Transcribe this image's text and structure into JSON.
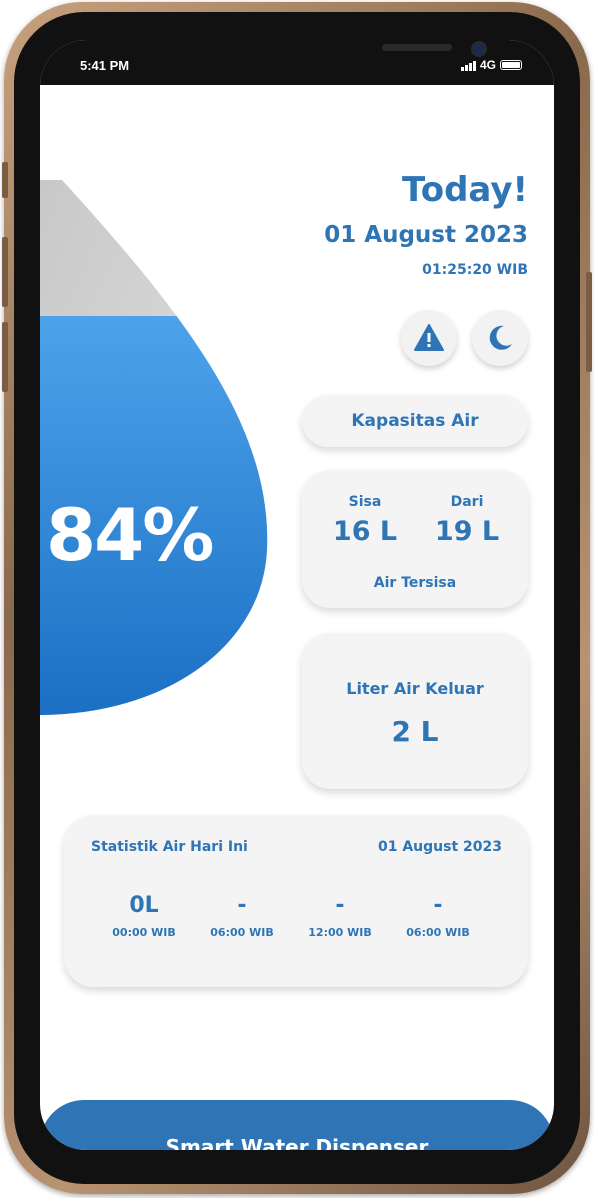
{
  "status_bar": {
    "time": "5:41 PM",
    "network": "4G",
    "icons": [
      "signal-icon",
      "battery-icon"
    ]
  },
  "header": {
    "title": "Today!",
    "date": "01 August 2023",
    "time": "01:25:20 WIB"
  },
  "actions": {
    "warning_icon": "warning-icon",
    "dark_mode_icon": "moon-icon"
  },
  "water_level": {
    "percent_label": "84%",
    "fill_fraction": 0.84
  },
  "capacity": {
    "label": "Kapasitas Air"
  },
  "remaining": {
    "sisa_label": "Sisa",
    "sisa_value": "16 L",
    "dari_label": "Dari",
    "dari_value": "19 L",
    "caption": "Air Tersisa"
  },
  "dispensed": {
    "label": "Liter Air Keluar",
    "value": "2 L"
  },
  "statistics": {
    "title": "Statistik Air Hari Ini",
    "date": "01 August 2023",
    "slots": [
      {
        "value": "0L",
        "time": "00:00 WIB"
      },
      {
        "value": "-",
        "time": "06:00 WIB"
      },
      {
        "value": "-",
        "time": "12:00 WIB"
      },
      {
        "value": "-",
        "time": "06:00 WIB"
      }
    ]
  },
  "footer": {
    "title": "Smart Water Dispenser"
  },
  "colors": {
    "primary": "#2f75b5",
    "drop_top": "#4da3ea",
    "drop_bottom": "#1a6fc4",
    "drop_empty": "#d9d9d9",
    "card_bg": "#f4f4f4"
  }
}
